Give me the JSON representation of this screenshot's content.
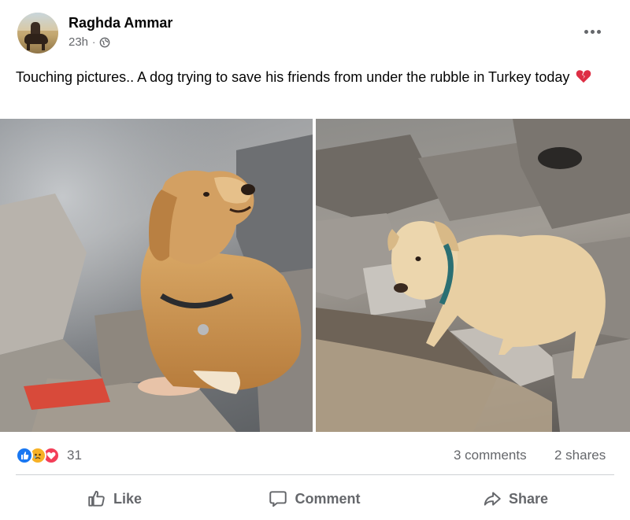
{
  "post": {
    "author": "Raghda Ammar",
    "time": "23h",
    "separator": "·",
    "privacy_icon": "globe-icon",
    "text": "Touching pictures.. A dog trying to save his friends from under the rubble in Turkey today",
    "text_emoji": "broken-heart-icon"
  },
  "photos": [
    {
      "icon": "photo-left",
      "description_visible": false
    },
    {
      "icon": "photo-right",
      "description_visible": false
    }
  ],
  "engagement": {
    "reactions": [
      "like-reaction-icon",
      "sad-reaction-icon",
      "love-reaction-icon"
    ],
    "reaction_count": "31",
    "comments": "3 comments",
    "shares": "2 shares"
  },
  "actions": {
    "like": "Like",
    "comment": "Comment",
    "share": "Share"
  },
  "colors": {
    "text_primary": "#050505",
    "text_secondary": "#65676b",
    "like_blue": "#1877f2",
    "love_red": "#f33e58",
    "sad_yellow": "#f7b125",
    "divider": "#ced0d4"
  }
}
